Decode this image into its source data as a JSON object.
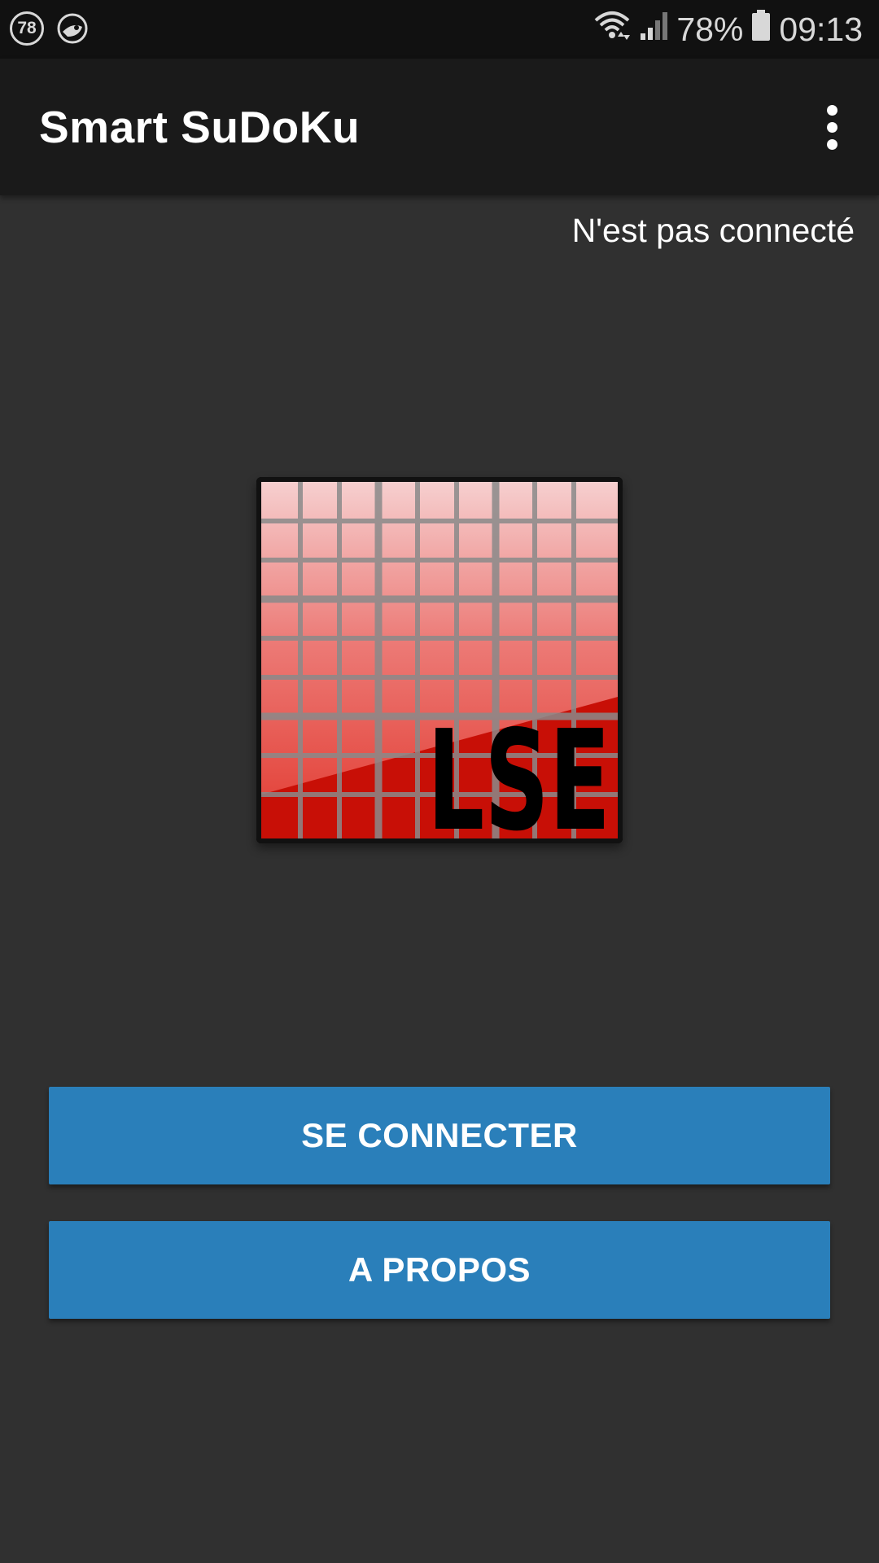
{
  "status_bar": {
    "notification_badge": "78",
    "notification_icons": [
      "notification-count-icon",
      "app-notification-icon"
    ],
    "system_icons": [
      "wifi-icon",
      "signal-icon",
      "battery-icon"
    ],
    "battery": "78%",
    "time": "09:13"
  },
  "app_bar": {
    "title": "Smart SuDoKu",
    "menu_icon": "more-vert-icon"
  },
  "main": {
    "connection_status": "N'est pas connecté",
    "logo_text": "LSE",
    "buttons": {
      "connect": "SE CONNECTER",
      "about": "A PROPOS"
    }
  },
  "colors": {
    "background": "#303030",
    "status_bar": "#111111",
    "app_bar": "#1a1a1a",
    "button": "#2a7fba",
    "logo_red": "#d01008"
  }
}
